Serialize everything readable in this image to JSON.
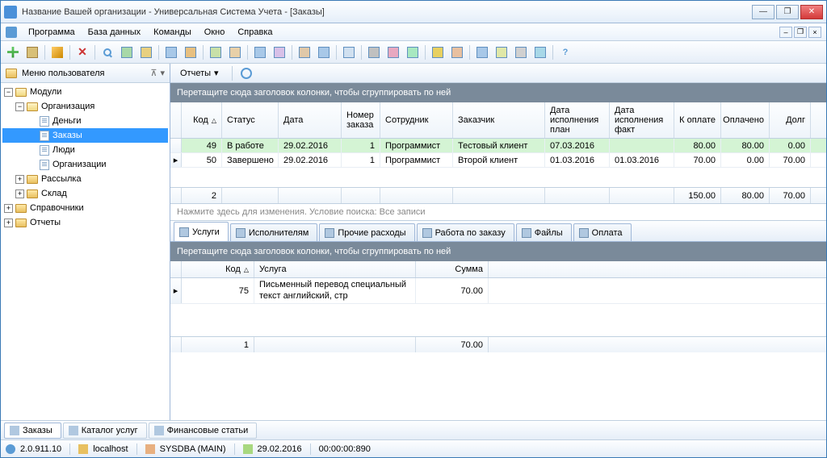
{
  "window": {
    "title": "Название Вашей организации - Универсальная Система Учета - [Заказы]"
  },
  "menu": [
    "Программа",
    "База данных",
    "Команды",
    "Окно",
    "Справка"
  ],
  "sidebar": {
    "title": "Меню пользователя",
    "nodes": {
      "modules": "Модули",
      "org": "Организация",
      "money": "Деньги",
      "orders": "Заказы",
      "people": "Люди",
      "orgs": "Организации",
      "mailing": "Рассылка",
      "warehouse": "Склад",
      "refs": "Справочники",
      "reports": "Отчеты"
    }
  },
  "reports": {
    "label": "Отчеты"
  },
  "grid": {
    "group_hint": "Перетащите сюда заголовок колонки, чтобы сгруппировать по ней",
    "headers": {
      "code": "Код",
      "status": "Статус",
      "date": "Дата",
      "ordno": "Номер заказа",
      "employee": "Сотрудник",
      "customer": "Заказчик",
      "date_plan": "Дата исполнения план",
      "date_fact": "Дата исполнения факт",
      "to_pay": "К оплате",
      "paid": "Оплачено",
      "debt": "Долг"
    },
    "rows": [
      {
        "code": "49",
        "status": "В работе",
        "date": "29.02.2016",
        "ordno": "1",
        "employee": "Программист",
        "customer": "Тестовый клиент",
        "date_plan": "07.03.2016",
        "date_fact": "",
        "to_pay": "80.00",
        "paid": "80.00",
        "debt": "0.00",
        "hl": true
      },
      {
        "code": "50",
        "status": "Завершено",
        "date": "29.02.2016",
        "ordno": "1",
        "employee": "Программист",
        "customer": "Второй клиент",
        "date_plan": "01.03.2016",
        "date_fact": "01.03.2016",
        "to_pay": "70.00",
        "paid": "0.00",
        "debt": "70.00",
        "hl": false,
        "cur": true
      }
    ],
    "footer": {
      "count": "2",
      "to_pay": "150.00",
      "paid": "80.00",
      "debt": "70.00"
    },
    "filter_hint": "Нажмите здесь для изменения. Условие поиска: Все записи"
  },
  "detail": {
    "tabs": [
      "Услуги",
      "Исполнителям",
      "Прочие расходы",
      "Работа по заказу",
      "Файлы",
      "Оплата"
    ],
    "group_hint": "Перетащите сюда заголовок колонки, чтобы сгруппировать по ней",
    "headers": {
      "code": "Код",
      "service": "Услуга",
      "sum": "Сумма"
    },
    "rows": [
      {
        "code": "75",
        "service": "Письменный перевод специальный текст английский, стр",
        "sum": "70.00"
      }
    ],
    "footer": {
      "count": "1",
      "sum": "70.00"
    }
  },
  "bottom_tabs": [
    "Заказы",
    "Каталог услуг",
    "Финансовые статьи"
  ],
  "status": {
    "version": "2.0.911.10",
    "host": "localhost",
    "user": "SYSDBA (MAIN)",
    "date": "29.02.2016",
    "time": "00:00:00:890"
  }
}
